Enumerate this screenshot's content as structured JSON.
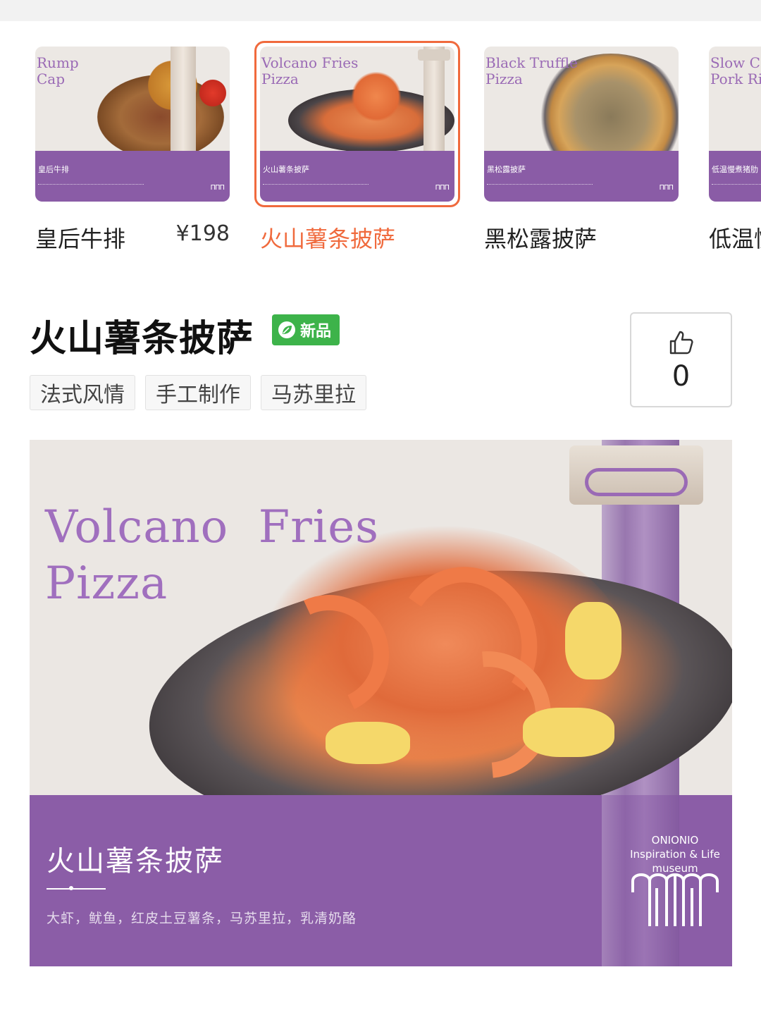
{
  "carousel": {
    "items": [
      {
        "en": "Rump\nCap",
        "band_cn": "皇后牛排",
        "name": "皇后牛排",
        "price": "¥198",
        "selected": false
      },
      {
        "en": "Volcano Fries\nPizza",
        "band_cn": "火山薯条披萨",
        "name": "火山薯条披萨",
        "price": "",
        "selected": true
      },
      {
        "en": "Black Truffle\nPizza",
        "band_cn": "黑松露披萨",
        "name": "黑松露披萨",
        "price": "",
        "selected": false
      },
      {
        "en": "Slow C\nPork Ri",
        "band_cn": "低温慢煮猪肋",
        "name": "低温慢",
        "price": "",
        "selected": false
      }
    ]
  },
  "detail": {
    "title": "火山薯条披萨",
    "badge": "新品",
    "tags": [
      "法式风情",
      "手工制作",
      "马苏里拉"
    ],
    "like_count": "0"
  },
  "hero": {
    "en_title": "Volcano  Fries\nPizza",
    "cn_title": "火山薯条披萨",
    "ingredients": "大虾，鱿鱼，红皮土豆薯条，马苏里拉，乳清奶酪",
    "brand": "ONIONIO\nInspiration & Life\nmuseum"
  },
  "colors": {
    "accent": "#f06a3d",
    "purple": "#8b5da7",
    "badge_green": "#3db34a"
  },
  "icons": {
    "like": "thumbs-up-icon",
    "badge": "leaf-icon"
  }
}
